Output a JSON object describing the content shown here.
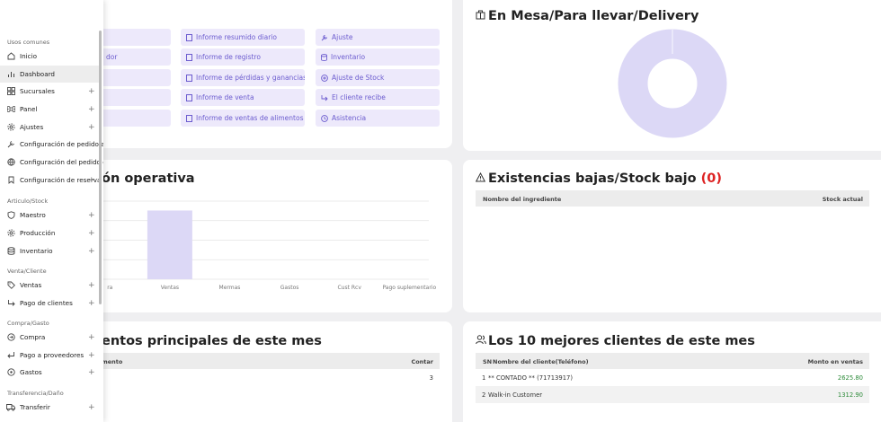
{
  "sidebar": {
    "sections": [
      {
        "title": "Usos comunes",
        "items": [
          {
            "label": "Inicio",
            "icon": "home-icon",
            "plus": false
          },
          {
            "label": "Dashboard",
            "icon": "bar-chart-icon",
            "plus": false,
            "active": true
          },
          {
            "label": "Sucursales",
            "icon": "grid-icon",
            "plus": true
          },
          {
            "label": "Panel",
            "icon": "command-icon",
            "plus": true
          },
          {
            "label": "Ajustes",
            "icon": "gear-icon",
            "plus": true
          },
          {
            "label": "Configuración de pedido autom",
            "icon": "wrench-icon",
            "plus": false
          },
          {
            "label": "Configuración del pedido en lí",
            "icon": "globe-icon",
            "plus": false
          },
          {
            "label": "Configuración de reserva",
            "icon": "bookmark-icon",
            "plus": true
          }
        ]
      },
      {
        "title": "Articulo/Stock",
        "items": [
          {
            "label": "Maestro",
            "icon": "shield-icon",
            "plus": true
          },
          {
            "label": "Producción",
            "icon": "gear-icon",
            "plus": true
          },
          {
            "label": "Inventario",
            "icon": "database-icon",
            "plus": true
          }
        ]
      },
      {
        "title": "Venta/Cliente",
        "items": [
          {
            "label": "Ventas",
            "icon": "tag-icon",
            "plus": true
          },
          {
            "label": "Pago de clientes",
            "icon": "arrow-return-icon",
            "plus": true
          }
        ]
      },
      {
        "title": "Compra/Gasto",
        "items": [
          {
            "label": "Compra",
            "icon": "circle-arrow-icon",
            "plus": true
          },
          {
            "label": "Pago a proveedores",
            "icon": "arrow-return-left-icon",
            "plus": true
          },
          {
            "label": "Gastos",
            "icon": "circle-icon",
            "plus": true
          }
        ]
      },
      {
        "title": "Transferencia/Daño",
        "items": [
          {
            "label": "Transferir",
            "icon": "truck-icon",
            "plus": true
          }
        ]
      }
    ]
  },
  "quick_links": {
    "col1": [
      "",
      "dor",
      "",
      "",
      ""
    ],
    "col2": [
      "Informe resumido diario",
      "Informe de registro",
      "Informe de pérdidas y ganancias",
      "Informe de venta",
      "Informe de ventas de alimentos"
    ],
    "col3": [
      "Ajuste",
      "Inventario",
      "Ajuste de Stock",
      "El cliente recibe",
      "Asistencia"
    ]
  },
  "dine_in": {
    "title": "En Mesa/Para llevar/Delivery",
    "accent": "#dcd8f6"
  },
  "operational": {
    "title": "ón operativa",
    "chart_data": {
      "type": "bar",
      "categories": [
        "ra",
        "Ventas",
        "Mermas",
        "Gastos",
        "Cust Rcv",
        "Pago suplementario"
      ],
      "values": [
        0,
        1,
        0,
        0,
        0,
        0
      ],
      "grid": true,
      "bar_color": "#dcd8f6"
    }
  },
  "low_stock": {
    "title_prefix": "Existencias bajas/Stock bajo",
    "count": "(0)",
    "columns": [
      "Nombre del ingrediente",
      "Stock actual"
    ]
  },
  "top_items": {
    "title": "entos principales de este mes",
    "columns": [
      "mento",
      "Contar"
    ],
    "rows": [
      {
        "name": "",
        "count": "3"
      }
    ]
  },
  "top_customers": {
    "title": "Los 10 mejores clientes de este mes",
    "columns": [
      "SN",
      "Nombre del cliente(Teléfono)",
      "Monto en ventas"
    ],
    "rows": [
      {
        "sn": "1",
        "name": "** CONTADO ** (71713917)",
        "amount": "2625.80"
      },
      {
        "sn": "2",
        "name": "Walk-in Customer",
        "amount": "1312.90"
      }
    ]
  },
  "colors": {
    "accent_purple": "#6c5ccf",
    "light_purple": "#ede9fb",
    "green": "#2e8b3a",
    "red": "#d22"
  }
}
